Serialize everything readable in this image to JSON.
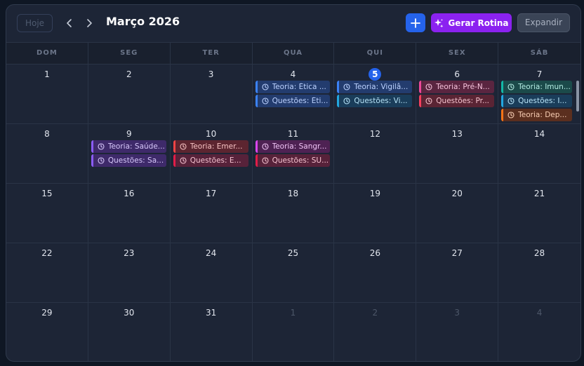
{
  "header": {
    "today_label": "Hoje",
    "month_title": "Março 2026",
    "generate_label": "Gerar Rotina",
    "expand_label": "Expandir"
  },
  "colors": {
    "accent": "#2563eb",
    "generate": "#8b22f0"
  },
  "weekdays": [
    "DOM",
    "SEG",
    "TER",
    "QUA",
    "QUI",
    "SEX",
    "SÁB"
  ],
  "weeks": [
    [
      {
        "day": "1",
        "muted": false,
        "events": []
      },
      {
        "day": "2",
        "muted": false,
        "events": []
      },
      {
        "day": "3",
        "muted": false,
        "events": []
      },
      {
        "day": "4",
        "muted": false,
        "events": [
          {
            "text": "Teoria: Ética ...",
            "color": "blue"
          },
          {
            "text": "Questões: Éti...",
            "color": "blue"
          }
        ]
      },
      {
        "day": "5",
        "muted": false,
        "today": true,
        "events": [
          {
            "text": "Teoria: Vigilâ...",
            "color": "blue"
          },
          {
            "text": "Questões: Vi...",
            "color": "cyan"
          }
        ]
      },
      {
        "day": "6",
        "muted": false,
        "events": [
          {
            "text": "Teoria: Pré-N...",
            "color": "pink"
          },
          {
            "text": "Questões: Pr...",
            "color": "rose"
          }
        ]
      },
      {
        "day": "7",
        "muted": false,
        "scroll": true,
        "events": [
          {
            "text": "Teoria: Imun...",
            "color": "teal"
          },
          {
            "text": "Questões: I...",
            "color": "cyan"
          },
          {
            "text": "Teoria: Dep...",
            "color": "orange"
          }
        ]
      }
    ],
    [
      {
        "day": "8",
        "muted": false,
        "events": []
      },
      {
        "day": "9",
        "muted": false,
        "events": [
          {
            "text": "Teoria: Saúde...",
            "color": "purple"
          },
          {
            "text": "Questões: Sa...",
            "color": "purple"
          }
        ]
      },
      {
        "day": "10",
        "muted": false,
        "events": [
          {
            "text": "Teoria: Emer...",
            "color": "red"
          },
          {
            "text": "Questões: E...",
            "color": "crimson"
          }
        ]
      },
      {
        "day": "11",
        "muted": false,
        "events": [
          {
            "text": "Teoria: Sangr...",
            "color": "magenta"
          },
          {
            "text": "Questões: SU...",
            "color": "crimson"
          }
        ]
      },
      {
        "day": "12",
        "muted": false,
        "events": []
      },
      {
        "day": "13",
        "muted": false,
        "events": []
      },
      {
        "day": "14",
        "muted": false,
        "events": []
      }
    ],
    [
      {
        "day": "15",
        "muted": false,
        "events": []
      },
      {
        "day": "16",
        "muted": false,
        "events": []
      },
      {
        "day": "17",
        "muted": false,
        "events": []
      },
      {
        "day": "18",
        "muted": false,
        "events": []
      },
      {
        "day": "19",
        "muted": false,
        "events": []
      },
      {
        "day": "20",
        "muted": false,
        "events": []
      },
      {
        "day": "21",
        "muted": false,
        "events": []
      }
    ],
    [
      {
        "day": "22",
        "muted": false,
        "events": []
      },
      {
        "day": "23",
        "muted": false,
        "events": []
      },
      {
        "day": "24",
        "muted": false,
        "events": []
      },
      {
        "day": "25",
        "muted": false,
        "events": []
      },
      {
        "day": "26",
        "muted": false,
        "events": []
      },
      {
        "day": "27",
        "muted": false,
        "events": []
      },
      {
        "day": "28",
        "muted": false,
        "events": []
      }
    ],
    [
      {
        "day": "29",
        "muted": false,
        "events": []
      },
      {
        "day": "30",
        "muted": false,
        "events": []
      },
      {
        "day": "31",
        "muted": false,
        "events": []
      },
      {
        "day": "1",
        "muted": true,
        "events": []
      },
      {
        "day": "2",
        "muted": true,
        "events": []
      },
      {
        "day": "3",
        "muted": true,
        "events": []
      },
      {
        "day": "4",
        "muted": true,
        "events": []
      }
    ]
  ]
}
